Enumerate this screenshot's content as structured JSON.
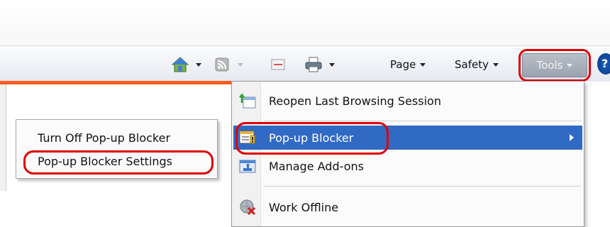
{
  "toolbar": {
    "home_icon": "home-icon",
    "feeds_icon": "feeds-icon",
    "mail_icon": "mail-icon",
    "print_icon": "print-icon",
    "page_label": "Page",
    "safety_label": "Safety",
    "tools_label": "Tools",
    "help_icon": "help-icon"
  },
  "tools_menu": {
    "items": [
      {
        "label": "Reopen Last Browsing Session",
        "icon": "reopen-session-icon"
      },
      {
        "label": "Pop-up Blocker",
        "icon": "popup-blocker-icon",
        "selected": true,
        "has_submenu": true
      },
      {
        "label": "Manage Add-ons",
        "icon": "addons-icon"
      },
      {
        "label": "Work Offline",
        "icon": "work-offline-icon"
      }
    ]
  },
  "popup_submenu": {
    "items": [
      {
        "label": "Turn Off Pop-up Blocker"
      },
      {
        "label": "Pop-up Blocker Settings"
      }
    ]
  },
  "colors": {
    "accent_line": "#ff5a1f",
    "selection": "#316ac5",
    "highlight_circle": "#e00000"
  }
}
